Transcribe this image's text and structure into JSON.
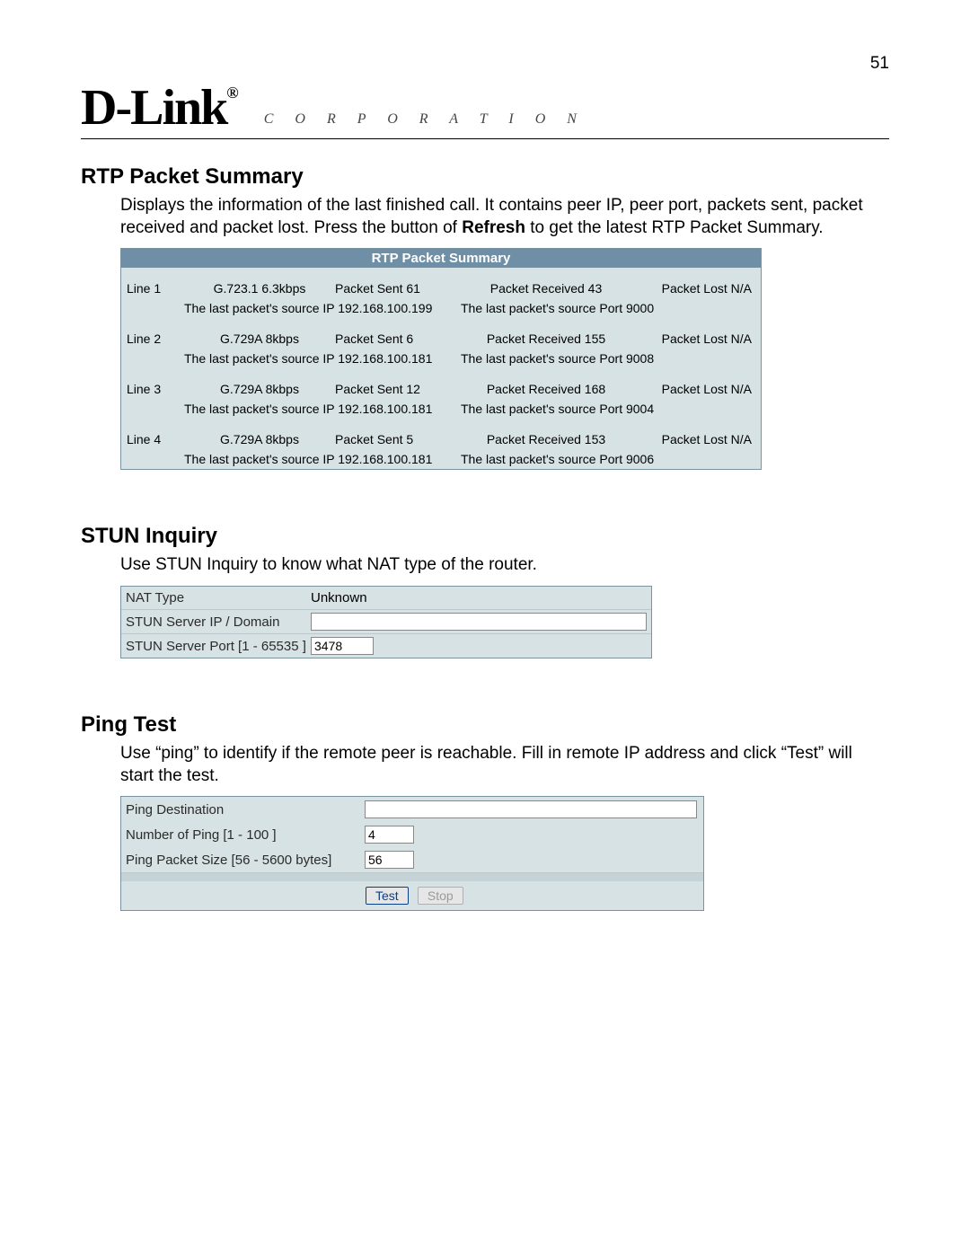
{
  "page_number": "51",
  "brand": {
    "name": "D-Link",
    "tagline": "C O R P O R A T I O N"
  },
  "rtp": {
    "title": "RTP Packet Summary",
    "desc_pre": "Displays the information of the last finished call. It contains peer IP, peer port, packets sent, packet received and packet lost. Press the button of ",
    "desc_bold": "Refresh",
    "desc_post": " to get the latest RTP Packet Summary.",
    "panel_title": "RTP Packet Summary",
    "lines": [
      {
        "line": "Line 1",
        "codec": "G.723.1 6.3kbps",
        "sent": "Packet Sent 61",
        "recv": "Packet Received 43",
        "lost": "Packet Lost N/A",
        "src_ip": "The last packet's source IP 192.168.100.199",
        "src_port": "The last packet's source Port 9000"
      },
      {
        "line": "Line 2",
        "codec": "G.729A 8kbps",
        "sent": "Packet Sent 6",
        "recv": "Packet Received 155",
        "lost": "Packet Lost N/A",
        "src_ip": "The last packet's source IP 192.168.100.181",
        "src_port": "The last packet's source Port 9008"
      },
      {
        "line": "Line 3",
        "codec": "G.729A 8kbps",
        "sent": "Packet Sent 12",
        "recv": "Packet Received 168",
        "lost": "Packet Lost N/A",
        "src_ip": "The last packet's source IP 192.168.100.181",
        "src_port": "The last packet's source Port 9004"
      },
      {
        "line": "Line 4",
        "codec": "G.729A 8kbps",
        "sent": "Packet Sent 5",
        "recv": "Packet Received 153",
        "lost": "Packet Lost N/A",
        "src_ip": "The last packet's source IP 192.168.100.181",
        "src_port": "The last packet's source Port 9006"
      }
    ]
  },
  "stun": {
    "title": "STUN Inquiry",
    "desc": "Use STUN Inquiry to know what NAT type of the router.",
    "rows": {
      "nat_type_label": "NAT Type",
      "nat_type_value": "Unknown",
      "server_label": "STUN Server IP / Domain",
      "server_value": "",
      "port_label": "STUN Server Port [1 - 65535 ]",
      "port_value": "3478"
    }
  },
  "ping": {
    "title": "Ping Test",
    "desc": "Use “ping” to identify if the remote peer is reachable. Fill in remote IP address and click “Test” will start the test.",
    "rows": {
      "dest_label": "Ping Destination",
      "dest_value": "",
      "count_label": "Number of Ping [1 - 100 ]",
      "count_value": "4",
      "size_label": "Ping Packet Size [56 - 5600 bytes]",
      "size_value": "56"
    },
    "test_btn": "Test",
    "stop_btn": "Stop"
  }
}
